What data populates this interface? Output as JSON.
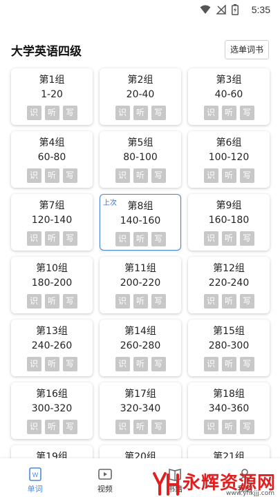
{
  "status": {
    "time": "5:35",
    "icons": [
      "wifi-icon",
      "no-signal-icon",
      "battery-charging-icon"
    ]
  },
  "header": {
    "title": "大学英语四级",
    "select_book_label": "选单词书"
  },
  "cards": [
    {
      "title": "第1组",
      "range": "1-20"
    },
    {
      "title": "第2组",
      "range": "20-40"
    },
    {
      "title": "第3组",
      "range": "40-60"
    },
    {
      "title": "第4组",
      "range": "60-80"
    },
    {
      "title": "第5组",
      "range": "80-100"
    },
    {
      "title": "第6组",
      "range": "100-120"
    },
    {
      "title": "第7组",
      "range": "120-140"
    },
    {
      "title": "第8组",
      "range": "140-160",
      "tag": "上次"
    },
    {
      "title": "第9组",
      "range": "160-180"
    },
    {
      "title": "第10组",
      "range": "180-200"
    },
    {
      "title": "第11组",
      "range": "200-220"
    },
    {
      "title": "第12组",
      "range": "220-240"
    },
    {
      "title": "第13组",
      "range": "240-260"
    },
    {
      "title": "第14组",
      "range": "260-280"
    },
    {
      "title": "第15组",
      "range": "280-300"
    },
    {
      "title": "第16组",
      "range": "300-320"
    },
    {
      "title": "第17组",
      "range": "320-340"
    },
    {
      "title": "第18组",
      "range": "340-360"
    },
    {
      "title": "第19组"
    },
    {
      "title": "第20组"
    },
    {
      "title": "第21组"
    }
  ],
  "card_actions": {
    "recognize": "识",
    "listen": "听",
    "write": "写"
  },
  "bottom_nav": [
    {
      "label": "单词",
      "icon": "word-book-icon",
      "active": true
    },
    {
      "label": "视频",
      "icon": "video-play-icon",
      "active": false
    },
    {
      "label": "书籍",
      "icon": "book-icon",
      "active": false
    },
    {
      "label": "我的",
      "icon": "profile-icon",
      "active": false
    }
  ],
  "watermark": {
    "text": "永辉资源网",
    "url": "www.yhkjjj.com"
  },
  "colors": {
    "accent": "#4a88e0",
    "action_bg": "#c8c8c8",
    "watermark": "#e02020"
  }
}
